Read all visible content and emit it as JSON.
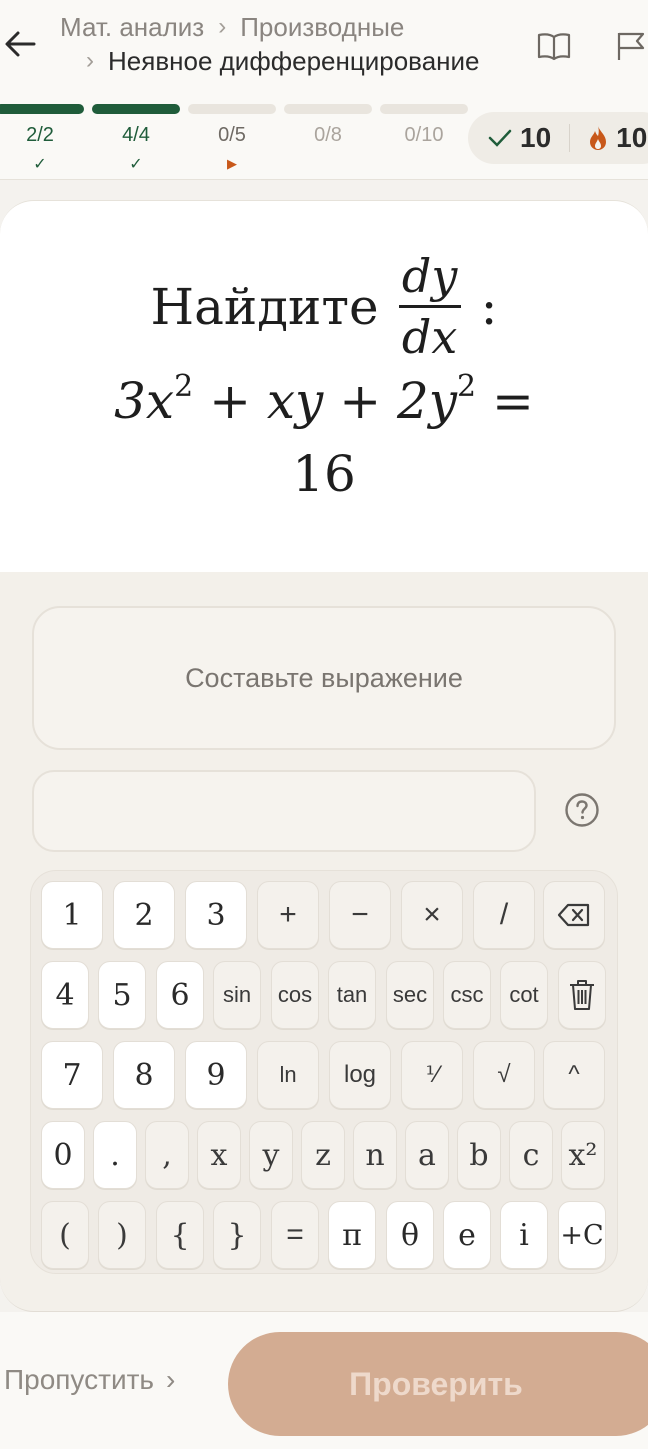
{
  "header": {
    "breadcrumb": {
      "root": "Мат. анализ",
      "section": "Производные",
      "current": "Неявное дифференцирование"
    }
  },
  "progress": {
    "segments": [
      {
        "label": "2/2",
        "state": "done",
        "mark": "✓"
      },
      {
        "label": "4/4",
        "state": "done",
        "mark": "✓"
      },
      {
        "label": "0/5",
        "state": "active",
        "mark": "▶"
      },
      {
        "label": "0/8",
        "state": "idle",
        "mark": ""
      },
      {
        "label": "0/10",
        "state": "idle",
        "mark": ""
      }
    ]
  },
  "stats": {
    "correct": "10",
    "streak": "10"
  },
  "question": {
    "prefix": "Найдите",
    "frac_num": "dy",
    "frac_den": "dx",
    "colon": ":",
    "eq_t1": "3x",
    "eq_exp1": "2",
    "eq_t2": " + xy + 2y",
    "eq_exp2": "2",
    "eq_t3": " =",
    "rhs": "16"
  },
  "answer": {
    "compose_placeholder": "Составьте выражение",
    "input_value": ""
  },
  "keypad": {
    "row1": [
      "1",
      "2",
      "3",
      "+",
      "−",
      "×",
      "/"
    ],
    "row2": [
      "4",
      "5",
      "6",
      "sin",
      "cos",
      "tan",
      "sec",
      "csc",
      "cot"
    ],
    "row3": [
      "7",
      "8",
      "9",
      "ln",
      "log",
      "⅟",
      "√",
      "^"
    ],
    "row4": [
      "0",
      ".",
      ",",
      "x",
      "y",
      "z",
      "n",
      "a",
      "b",
      "c",
      "x²"
    ],
    "row5": [
      "(",
      ")",
      "{",
      "}",
      "=",
      "π",
      "θ",
      "e",
      "i",
      "+C"
    ]
  },
  "footer": {
    "skip_label": "Пропустить",
    "check_label": "Проверить"
  },
  "colors": {
    "accent_green": "#1f5c3a",
    "accent_orange": "#c8581a",
    "check_button": "#d3ac92"
  }
}
